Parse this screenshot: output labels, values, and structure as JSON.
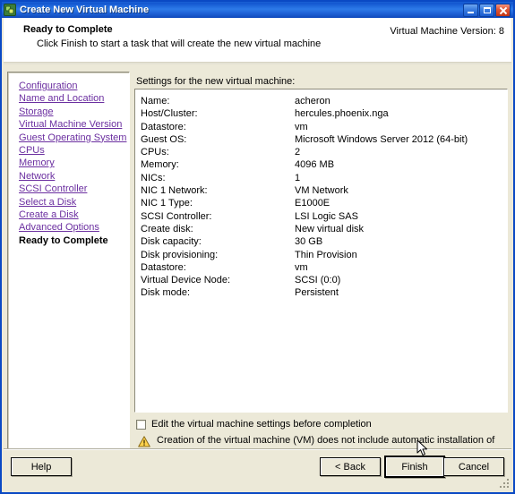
{
  "window": {
    "title": "Create New Virtual Machine",
    "icon": "virtual-machine-icon",
    "titlebar_buttons": {
      "minimize": "Minimize",
      "maximize": "Maximize",
      "close": "Close"
    },
    "accent_color": "#1255cf",
    "dialog_background": "#ece9d8"
  },
  "header": {
    "title": "Ready to Complete",
    "subtitle": "Click Finish to start a task that will create the new virtual machine",
    "version_label": "Virtual Machine Version: 8"
  },
  "sidebar": {
    "items": [
      {
        "label": "Configuration",
        "current": false
      },
      {
        "label": "Name and Location",
        "current": false
      },
      {
        "label": "Storage",
        "current": false
      },
      {
        "label": "Virtual Machine Version",
        "current": false
      },
      {
        "label": "Guest Operating System",
        "current": false
      },
      {
        "label": "CPUs",
        "current": false
      },
      {
        "label": "Memory",
        "current": false
      },
      {
        "label": "Network",
        "current": false
      },
      {
        "label": "SCSI Controller",
        "current": false
      },
      {
        "label": "Select a Disk",
        "current": false
      },
      {
        "label": "Create a Disk",
        "current": false
      },
      {
        "label": "Advanced Options",
        "current": false
      },
      {
        "label": "Ready to Complete",
        "current": true
      }
    ],
    "link_color": "#6b2fa0"
  },
  "main": {
    "settings_caption": "Settings for the new virtual machine:",
    "settings": [
      {
        "key": "Name:",
        "value": "acheron"
      },
      {
        "key": "Host/Cluster:",
        "value": "hercules.phoenix.nga"
      },
      {
        "key": "Datastore:",
        "value": "vm"
      },
      {
        "key": "Guest OS:",
        "value": "Microsoft Windows Server 2012 (64-bit)"
      },
      {
        "key": "CPUs:",
        "value": "2"
      },
      {
        "key": "Memory:",
        "value": "4096 MB"
      },
      {
        "key": "NICs:",
        "value": "1"
      },
      {
        "key": "NIC 1 Network:",
        "value": "VM Network"
      },
      {
        "key": "NIC 1 Type:",
        "value": "E1000E"
      },
      {
        "key": "SCSI Controller:",
        "value": "LSI Logic SAS"
      },
      {
        "key": "Create disk:",
        "value": "New virtual disk"
      },
      {
        "key": "Disk capacity:",
        "value": "30 GB"
      },
      {
        "key": "Disk provisioning:",
        "value": "Thin Provision"
      },
      {
        "key": "Datastore:",
        "value": "vm"
      },
      {
        "key": "Virtual Device Node:",
        "value": "SCSI (0:0)"
      },
      {
        "key": "Disk mode:",
        "value": "Persistent"
      }
    ],
    "edit_checkbox": {
      "label": "Edit the virtual machine settings before completion",
      "checked": false
    },
    "warning": {
      "icon": "warning-triangle-icon",
      "text": "Creation of the virtual machine (VM) does not include automatic installation of the guest operating system. Install a guest OS on the VM after creating the VM.",
      "color": "#ffd24d"
    }
  },
  "footer": {
    "help_label": "Help",
    "back_label": "< Back",
    "finish_label": "Finish",
    "cancel_label": "Cancel"
  }
}
